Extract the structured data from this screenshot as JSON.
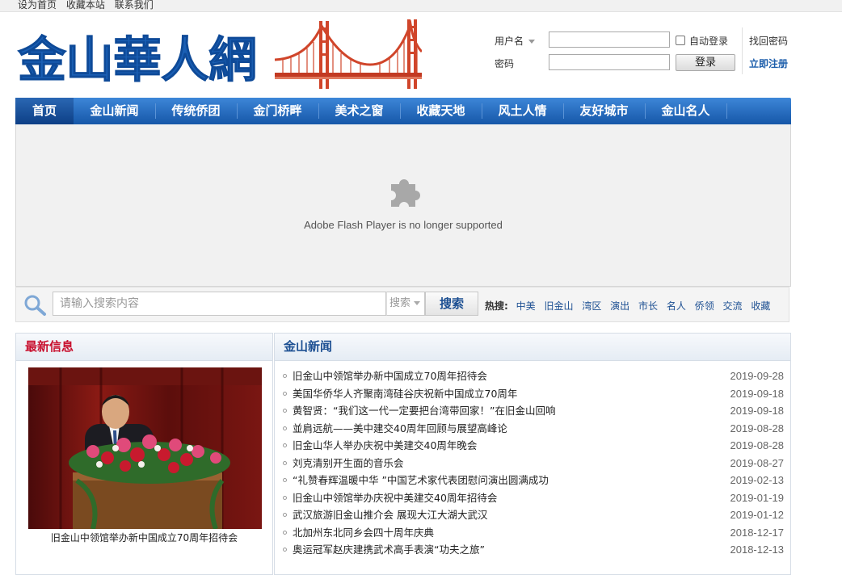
{
  "topbar": {
    "links": [
      "设为首页",
      "收藏本站",
      "联系我们"
    ]
  },
  "logo": {
    "text": "金山華人網"
  },
  "login": {
    "username_label": "用户名",
    "password_label": "密码",
    "auto_login": "自动登录",
    "login_button": "登录",
    "forgot": "找回密码",
    "register": "立即注册"
  },
  "nav": [
    "首页",
    "金山新闻",
    "传统侨团",
    "金门桥畔",
    "美术之窗",
    "收藏天地",
    "风土人情",
    "友好城市",
    "金山名人"
  ],
  "flash": {
    "message": "Adobe Flash Player is no longer supported",
    "icon": "puzzle-icon"
  },
  "search": {
    "placeholder": "请输入搜索内容",
    "type": "搜索",
    "button": "搜索",
    "hot_label": "热搜:",
    "hot_tags": [
      "中美",
      "旧金山",
      "湾区",
      "演出",
      "市长",
      "名人",
      "侨领",
      "交流",
      "收藏"
    ]
  },
  "latest": {
    "title": "最新信息",
    "caption": "旧金山中领馆举办新中国成立70周年招待会"
  },
  "news": {
    "title": "金山新闻",
    "items": [
      {
        "title": "旧金山中领馆举办新中国成立70周年招待会",
        "date": "2019-09-28"
      },
      {
        "title": "美国华侨华人齐聚南湾硅谷庆祝新中国成立70周年",
        "date": "2019-09-18"
      },
      {
        "title": "黄智贤：“我们这一代一定要把台湾带回家！”在旧金山回响",
        "date": "2019-09-18"
      },
      {
        "title": "並肩远航——美中建交40周年回顾与展望高峰论",
        "date": "2019-08-28"
      },
      {
        "title": "旧金山华人举办庆祝中美建交40周年晚会",
        "date": "2019-08-28"
      },
      {
        "title": "刘克清别开生面的音乐会",
        "date": "2019-08-27"
      },
      {
        "title": "“礼赞春辉温暖中华 ”中国艺术家代表团慰问演出圆满成功",
        "date": "2019-02-13"
      },
      {
        "title": "旧金山中领馆举办庆祝中美建交40周年招待会",
        "date": "2019-01-19"
      },
      {
        "title": "武汉旅游旧金山推介会 展现大江大湖大武汉",
        "date": "2019-01-12"
      },
      {
        "title": "北加州东北同乡会四十周年庆典",
        "date": "2018-12-17"
      },
      {
        "title": "奥运冠军赵庆建携武术高手表演“功夫之旅”",
        "date": "2018-12-13"
      }
    ]
  },
  "colors": {
    "nav_blue": "#1657a8",
    "logo_blue": "#1a5fb4",
    "bridge_red": "#d0452a",
    "latest_red": "#c8102e"
  }
}
